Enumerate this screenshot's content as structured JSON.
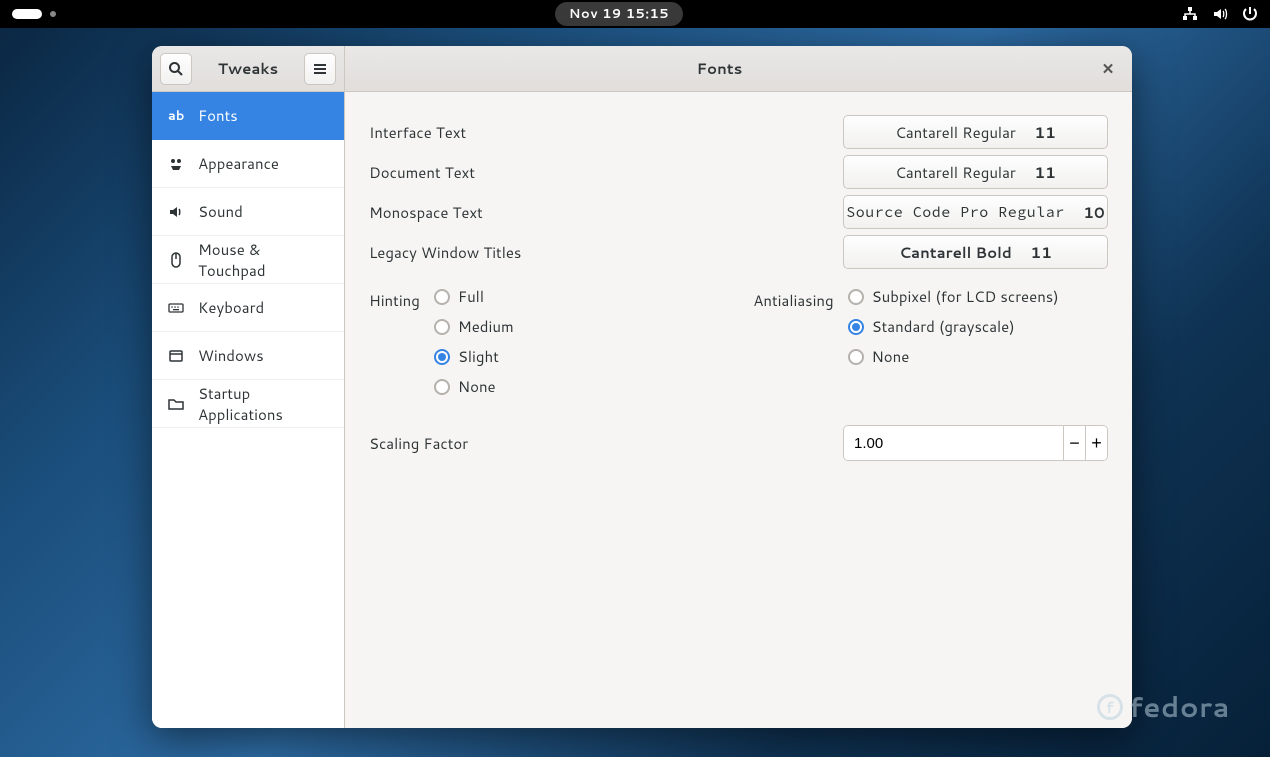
{
  "topbar": {
    "datetime": "Nov 19  15:15"
  },
  "header": {
    "app_title": "Tweaks",
    "page_title": "Fonts"
  },
  "sidebar": {
    "items": [
      {
        "label": "Fonts",
        "selected": true
      },
      {
        "label": "Appearance",
        "selected": false
      },
      {
        "label": "Sound",
        "selected": false
      },
      {
        "label": "Mouse & Touchpad",
        "selected": false
      },
      {
        "label": "Keyboard",
        "selected": false
      },
      {
        "label": "Windows",
        "selected": false
      },
      {
        "label": "Startup Applications",
        "selected": false
      }
    ]
  },
  "fonts": {
    "interface": {
      "label": "Interface Text",
      "name": "Cantarell Regular",
      "size": "11"
    },
    "document": {
      "label": "Document Text",
      "name": "Cantarell Regular",
      "size": "11"
    },
    "monospace": {
      "label": "Monospace Text",
      "name": "Source Code Pro Regular",
      "size": "10"
    },
    "legacy": {
      "label": "Legacy Window Titles",
      "name": "Cantarell Bold",
      "size": "11"
    }
  },
  "hinting": {
    "label": "Hinting",
    "options": [
      {
        "label": "Full",
        "checked": false
      },
      {
        "label": "Medium",
        "checked": false
      },
      {
        "label": "Slight",
        "checked": true
      },
      {
        "label": "None",
        "checked": false
      }
    ]
  },
  "antialiasing": {
    "label": "Antialiasing",
    "options": [
      {
        "label": "Subpixel (for LCD screens)",
        "checked": false
      },
      {
        "label": "Standard (grayscale)",
        "checked": true
      },
      {
        "label": "None",
        "checked": false
      }
    ]
  },
  "scaling": {
    "label": "Scaling Factor",
    "value": "1.00"
  },
  "branding": {
    "distro": "fedora"
  }
}
